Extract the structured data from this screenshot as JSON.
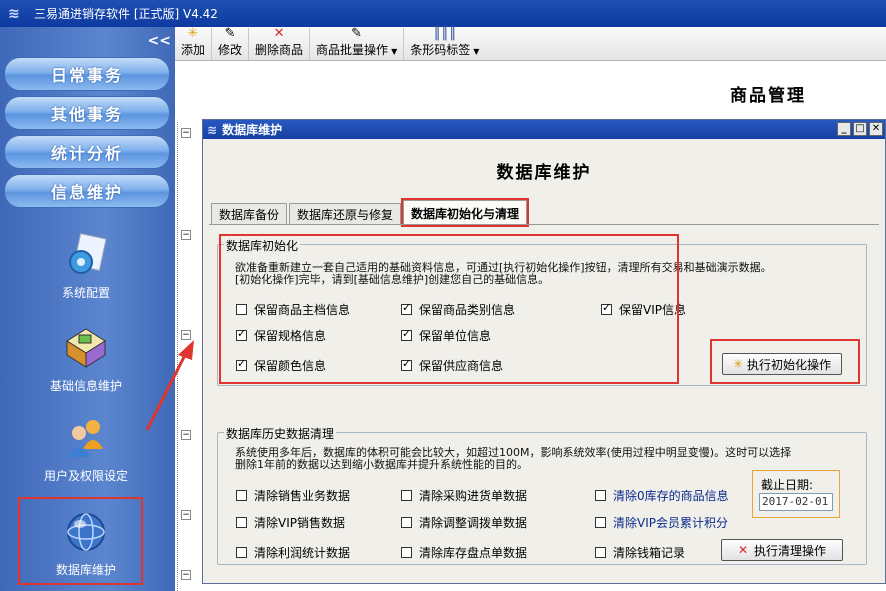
{
  "window": {
    "title": "三易通进销存软件 [正式版] V4.42"
  },
  "sidebar": {
    "collapse": "<<",
    "nav": [
      "日常事务",
      "其他事务",
      "统计分析",
      "信息维护"
    ],
    "tools": [
      {
        "label": "系统配置",
        "icon": "gear-document-icon"
      },
      {
        "label": "基础信息维护",
        "icon": "boxes-icon"
      },
      {
        "label": "用户及权限设定",
        "icon": "users-icon"
      },
      {
        "label": "数据库维护",
        "icon": "globe-icon"
      }
    ]
  },
  "toolbar": {
    "add": "添加",
    "edit": "修改",
    "delete": "删除商品",
    "batch": "商品批量操作",
    "barcode": "条形码标签"
  },
  "main": {
    "title": "商品管理"
  },
  "dialog": {
    "title": "数据库维护",
    "heading": "数据库维护",
    "tabs": [
      "数据库备份",
      "数据库还原与修复",
      "数据库初始化与清理"
    ],
    "init": {
      "title": "数据库初始化",
      "desc1": "欲准备重新建立一套自己适用的基础资料信息，可通过[执行初始化操作]按钮，清理所有交易和基础演示数据。",
      "desc2": "[初始化操作]完毕，请到[基础信息维护]创建您自己的基础信息。",
      "options": [
        {
          "label": "保留商品主档信息",
          "checked": false
        },
        {
          "label": "保留商品类别信息",
          "checked": true
        },
        {
          "label": "保留VIP信息",
          "checked": true
        },
        {
          "label": "保留规格信息",
          "checked": true
        },
        {
          "label": "保留单位信息",
          "checked": true
        },
        {
          "label": "保留颜色信息",
          "checked": true
        },
        {
          "label": "保留供应商信息",
          "checked": true
        }
      ],
      "button": "执行初始化操作"
    },
    "cleanup": {
      "title": "数据库历史数据清理",
      "desc1": "系统使用多年后，数据库的体积可能会比较大，如超过100M，影响系统效率(使用过程中明显变慢)。这时可以选择",
      "desc2": "删除1年前的数据以达到缩小数据库并提升系统性能的目的。",
      "options": [
        {
          "label": "清除销售业务数据",
          "checked": false
        },
        {
          "label": "清除采购进货单数据",
          "checked": false
        },
        {
          "label": "清除0库存的商品信息",
          "checked": false
        },
        {
          "label": "清除VIP销售数据",
          "checked": false
        },
        {
          "label": "清除调整调拨单数据",
          "checked": false
        },
        {
          "label": "清除VIP会员累计积分",
          "checked": false
        },
        {
          "label": "清除利润统计数据",
          "checked": false
        },
        {
          "label": "清除库存盘点单数据",
          "checked": false
        },
        {
          "label": "清除钱箱记录",
          "checked": false
        }
      ],
      "date_label": "截止日期:",
      "date_value": "2017-02-01",
      "button": "执行清理操作"
    }
  },
  "colors": {
    "highlight": "#e0342f",
    "titlebar": "#1f4fb3",
    "sidebar": "#5b86cf"
  }
}
